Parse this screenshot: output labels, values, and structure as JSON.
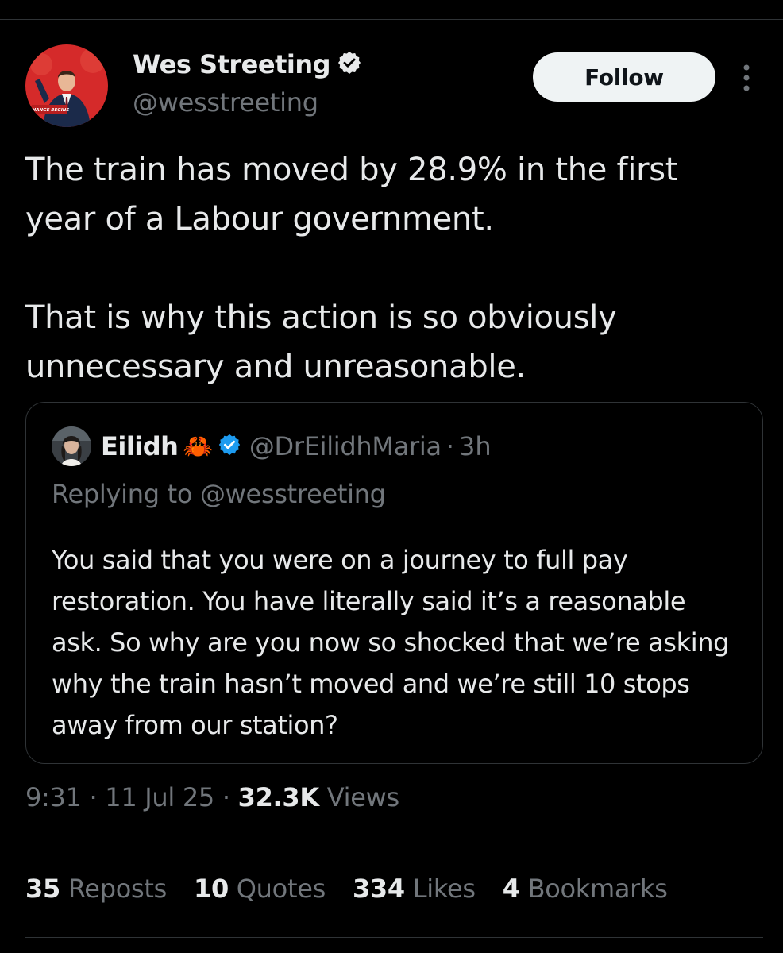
{
  "author": {
    "name": "Wes Streeting",
    "handle": "@wesstreeting",
    "verified": true,
    "avatar_banner_text": "CHANGE BEGINS"
  },
  "follow_label": "Follow",
  "tweet": {
    "paragraphs": [
      "The train has moved by 28.9% in the first year of a Labour government.",
      "That is why this action is so obviously unnecessary and unreasonable."
    ]
  },
  "quote": {
    "name": "Eilidh",
    "emoji": "🦀",
    "verified": true,
    "handle": "@DrEilidhMaria",
    "separator": "·",
    "time": "3h",
    "replying_to": "Replying to @wesstreeting",
    "text": "You said that you were on a journey to full pay restoration. You have literally said it’s a reasonable ask. So why are you now so shocked that we’re asking why the train hasn’t moved and we’re still 10 stops away from our station?"
  },
  "meta": {
    "time": "9:31",
    "sep1": "·",
    "date": "11 Jul 25",
    "sep2": "·",
    "views_count": "32.3K",
    "views_label": "Views"
  },
  "stats": [
    {
      "count": "35",
      "label": "Reposts"
    },
    {
      "count": "10",
      "label": "Quotes"
    },
    {
      "count": "334",
      "label": "Likes"
    },
    {
      "count": "4",
      "label": "Bookmarks"
    }
  ],
  "colors": {
    "background": "#000000",
    "text_primary": "#e7e9ea",
    "text_secondary": "#71767b",
    "divider": "#2f3336",
    "verified_badge": "#1d9bf0",
    "avatar_red": "#d52a2a"
  },
  "icons": {
    "verified": "verified-badge-icon",
    "more": "more-options-icon"
  }
}
